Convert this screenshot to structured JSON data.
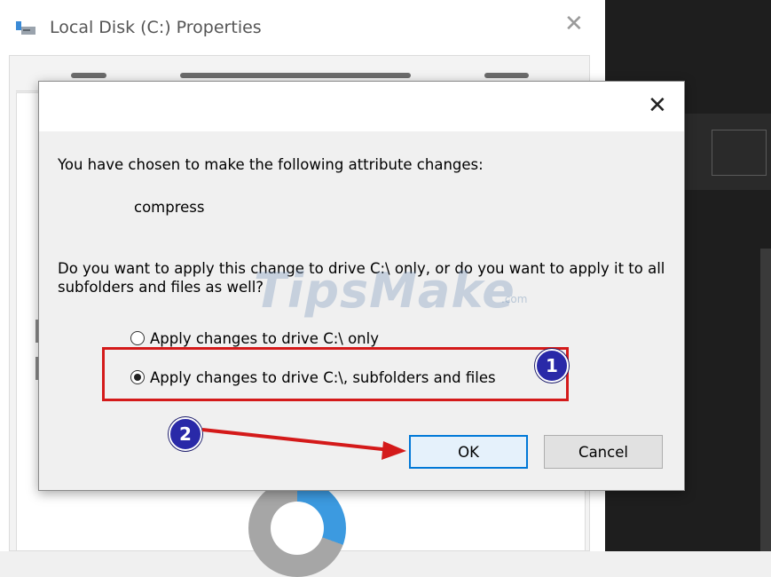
{
  "background_window": {
    "title": "Local Disk (C:) Properties",
    "close_glyph": "✕"
  },
  "dialog": {
    "close_glyph": "✕",
    "message": "You have chosen to make the following attribute changes:",
    "attribute": "compress",
    "question": "Do you want to apply this change to drive C:\\ only, or do you want to apply it to all subfolders and files as well?",
    "options": [
      {
        "label": "Apply changes to drive C:\\ only",
        "selected": false
      },
      {
        "label": "Apply changes to drive C:\\, subfolders and files",
        "selected": true
      }
    ],
    "ok_label": "OK",
    "cancel_label": "Cancel"
  },
  "watermark": {
    "text": "TipsMake",
    "suffix": ".com"
  },
  "annotations": {
    "badge_1": "1",
    "badge_2": "2",
    "highlight_color": "#d41a1a",
    "badge_color": "#2929a8"
  },
  "icons": [
    "drive-icon",
    "close-icon",
    "radio-button-icon"
  ]
}
